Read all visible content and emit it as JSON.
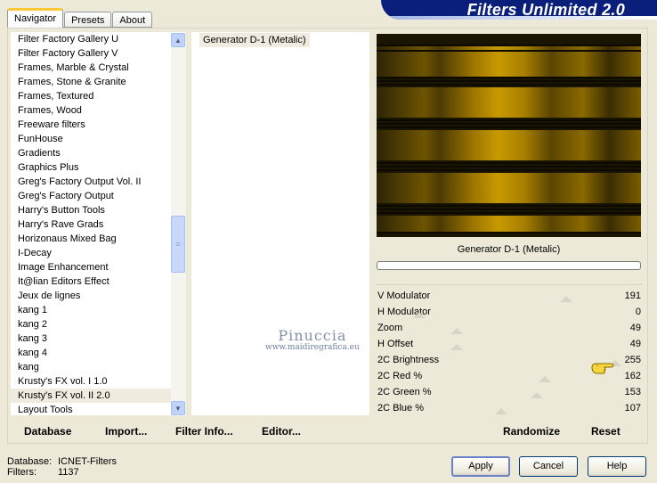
{
  "tabs": [
    "Navigator",
    "Presets",
    "About"
  ],
  "banner_title": "Filters Unlimited 2.0",
  "categories": [
    "Filter Factory Gallery U",
    "Filter Factory Gallery V",
    "Frames, Marble & Crystal",
    "Frames, Stone & Granite",
    "Frames, Textured",
    "Frames, Wood",
    "Freeware filters",
    "FunHouse",
    "Gradients",
    "Graphics Plus",
    "Greg's Factory Output Vol. II",
    "Greg's Factory Output",
    "Harry's Button Tools",
    "Harry's Rave Grads",
    "Horizonaus Mixed Bag",
    "I-Decay",
    "Image Enhancement",
    "It@lian Editors Effect",
    "Jeux de lignes",
    "kang 1",
    "kang 2",
    "kang 3",
    "kang 4",
    "kang",
    "Krusty's FX vol. I 1.0",
    "Krusty's FX vol. II 2.0",
    "Layout Tools"
  ],
  "selected_category": "Krusty's FX vol. II 2.0",
  "filters": [
    "Generator D-1 (Metalic)"
  ],
  "effect_name": "Generator D-1 (Metalic)",
  "sliders": [
    {
      "label": "V Modulator",
      "value": "191",
      "fraction": 0.75
    },
    {
      "label": "H Modulator",
      "value": "0",
      "fraction": 0.0
    },
    {
      "label": "Zoom",
      "value": "49",
      "fraction": 0.19
    },
    {
      "label": "H Offset",
      "value": "49",
      "fraction": 0.19
    },
    {
      "label": "2C Brightness",
      "value": "255",
      "fraction": 1.0
    },
    {
      "label": "2C Red %",
      "value": "162",
      "fraction": 0.64
    },
    {
      "label": "2C Green %",
      "value": "153",
      "fraction": 0.6
    },
    {
      "label": "2C Blue %",
      "value": "107",
      "fraction": 0.42
    }
  ],
  "left_buttons": {
    "database": "Database",
    "import": "Import...",
    "filter_info": "Filter Info...",
    "editor": "Editor..."
  },
  "right_buttons": {
    "randomize": "Randomize",
    "reset": "Reset"
  },
  "footer": {
    "database_label": "Database:",
    "database_value": "ICNET-Filters",
    "filters_label": "Filters:",
    "filters_value": "1137"
  },
  "dialog_buttons": {
    "apply": "Apply",
    "cancel": "Cancel",
    "help": "Help"
  },
  "watermark": {
    "name": "Pinuccia",
    "site": "www.maidiregrafica.eu"
  }
}
